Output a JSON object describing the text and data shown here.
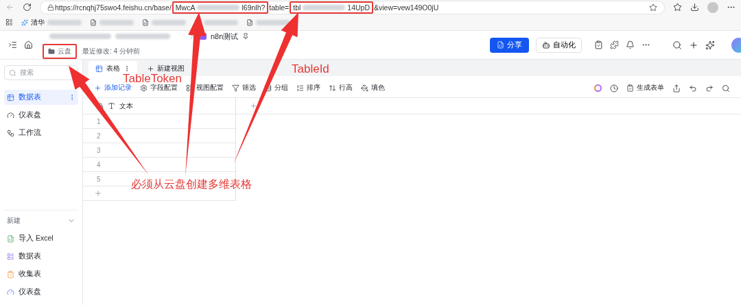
{
  "browser": {
    "url_parts": [
      {
        "kind": "text",
        "text": "https://rcnqhj75swo4.feishu.cn/base/"
      },
      {
        "kind": "highlight",
        "parts": [
          {
            "kind": "text",
            "text": "MwcA"
          },
          {
            "kind": "blur"
          },
          {
            "kind": "text",
            "text": "l69nlh?"
          }
        ]
      },
      {
        "kind": "text",
        "text": "table="
      },
      {
        "kind": "highlight",
        "parts": [
          {
            "kind": "text",
            "text": "tbl"
          },
          {
            "kind": "blur"
          },
          {
            "kind": "text",
            "text": "14UpD"
          }
        ]
      },
      {
        "kind": "text",
        "text": "&view=vew149O0jU"
      }
    ],
    "bookmarks": [
      {
        "kind": "app",
        "text": "清华"
      },
      {
        "kind": "page"
      },
      {
        "kind": "page"
      },
      {
        "kind": "page"
      },
      {
        "kind": "page"
      }
    ]
  },
  "header": {
    "location": "云盘",
    "modified": "最近修改: 4 分钟前",
    "doc_title": "n8n测试",
    "share": "分享",
    "automation": "自动化"
  },
  "sidebar": {
    "search_placeholder": "搜索",
    "items": [
      {
        "kind": "table",
        "label": "数据表",
        "selected": true
      },
      {
        "kind": "dashboard",
        "label": "仪表盘",
        "selected": false
      },
      {
        "kind": "workflow",
        "label": "工作流",
        "selected": false
      }
    ],
    "new_label": "新建",
    "create_items": [
      {
        "kind": "excel",
        "label": "导入 Excel"
      },
      {
        "kind": "table",
        "label": "数据表"
      },
      {
        "kind": "form",
        "label": "收集表"
      },
      {
        "kind": "dashboard",
        "label": "仪表盘"
      }
    ]
  },
  "tabs": [
    {
      "label": "表格",
      "selected": true
    }
  ],
  "new_view": "新建视图",
  "toolbar": [
    {
      "kind": "add",
      "label": "添加记录"
    },
    {
      "kind": "fields",
      "label": "字段配置"
    },
    {
      "kind": "view",
      "label": "视图配置"
    },
    {
      "kind": "filter",
      "label": "筛选"
    },
    {
      "kind": "group",
      "label": "分组"
    },
    {
      "kind": "sort",
      "label": "排序"
    },
    {
      "kind": "height",
      "label": "行高"
    },
    {
      "kind": "color",
      "label": "填色"
    }
  ],
  "generate_form": "生成表单",
  "table": {
    "column": "文本",
    "rows": [
      "1",
      "2",
      "3",
      "4",
      "5"
    ]
  },
  "annotations": {
    "token_label": "TableToken",
    "table_label": "TableId",
    "note": "必须从云盘创建多维表格"
  }
}
